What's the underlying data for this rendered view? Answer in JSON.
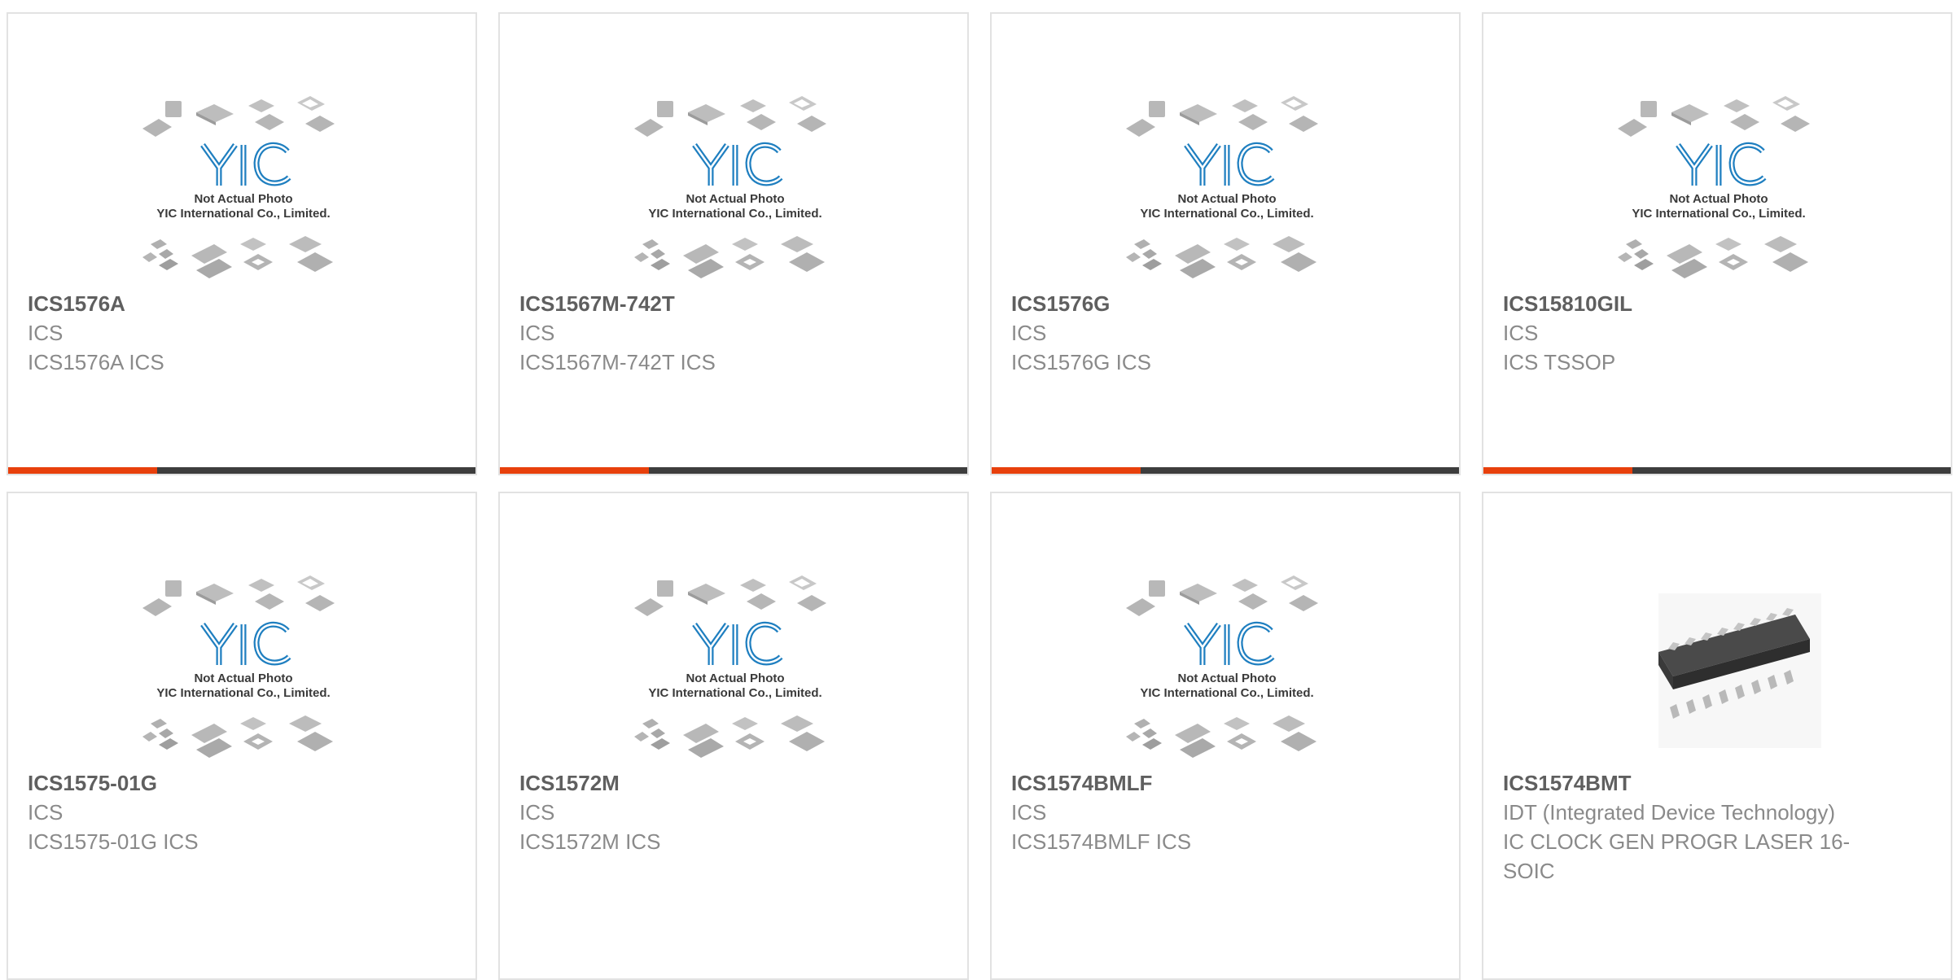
{
  "placeholder": {
    "line1": "Not Actual Photo",
    "line2": "YIC International Co., Limited."
  },
  "colors": {
    "accent": "#e8400c",
    "bar": "#3d3d3d",
    "logo": "#1f7fc0"
  },
  "products": [
    {
      "part": "ICS1576A",
      "mfr": "ICS",
      "desc": "ICS1576A ICS",
      "image": "placeholder"
    },
    {
      "part": "ICS1567M-742T",
      "mfr": "ICS",
      "desc": "ICS1567M-742T ICS",
      "image": "placeholder"
    },
    {
      "part": "ICS1576G",
      "mfr": "ICS",
      "desc": "ICS1576G ICS",
      "image": "placeholder"
    },
    {
      "part": "ICS15810GIL",
      "mfr": "ICS",
      "desc": "ICS TSSOP",
      "image": "placeholder"
    },
    {
      "part": "ICS1575-01G",
      "mfr": "ICS",
      "desc": "ICS1575-01G ICS",
      "image": "placeholder"
    },
    {
      "part": "ICS1572M",
      "mfr": "ICS",
      "desc": "ICS1572M ICS",
      "image": "placeholder"
    },
    {
      "part": "ICS1574BMLF",
      "mfr": "ICS",
      "desc": "ICS1574BMLF ICS",
      "image": "placeholder"
    },
    {
      "part": "ICS1574BMT",
      "mfr": "IDT (Integrated Device Technology)",
      "desc": "IC CLOCK GEN PROGR LASER 16-SOIC",
      "image": "soic-chip"
    }
  ]
}
